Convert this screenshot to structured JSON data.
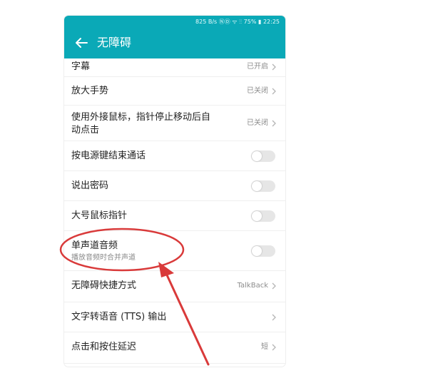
{
  "status_bar": {
    "text": "825 B/s ⓃⒹ ᯤ ⫶⫶ 75% ▮ 22:25"
  },
  "toolbar": {
    "title": "无障碍"
  },
  "settings": [
    {
      "title": "字幕",
      "value": "已开启"
    },
    {
      "title": "放大手势",
      "value": "已关闭"
    },
    {
      "title_line1": "使用外接鼠标，指针停止移动后自",
      "title_line2": "动点击",
      "value": "已关闭"
    },
    {
      "title": "按电源键结束通话",
      "toggle": "off"
    },
    {
      "title": "说出密码",
      "toggle": "off"
    },
    {
      "title": "大号鼠标指针",
      "toggle": "off"
    },
    {
      "title": "单声道音频",
      "subtitle": "播放音频时合并声道",
      "toggle": "off"
    },
    {
      "title": "无障碍快捷方式",
      "value": "TalkBack"
    },
    {
      "title": "文字转语音 (TTS) 输出"
    },
    {
      "title": "点击和按住延迟",
      "value": "短"
    }
  ],
  "colors": {
    "accent": "#0aa9b7",
    "annotation": "#d93a3a"
  }
}
